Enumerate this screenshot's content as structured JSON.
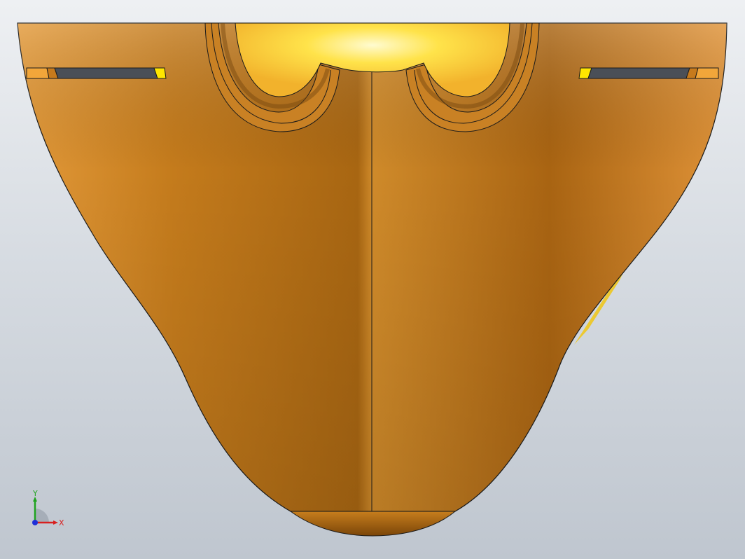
{
  "viewport": {
    "background_top": "#eef0f3",
    "background_bottom": "#bfc6cf"
  },
  "model": {
    "body_color": "#c9801f",
    "edge_color": "#1a1a1a",
    "highlight_color": "#ffe600",
    "slot_color": "#4a4f57"
  },
  "triad": {
    "x_label": "X",
    "y_label": "Y",
    "x_color": "#d81f1f",
    "y_color": "#1fa31f",
    "z_color": "#1f2fd8"
  }
}
